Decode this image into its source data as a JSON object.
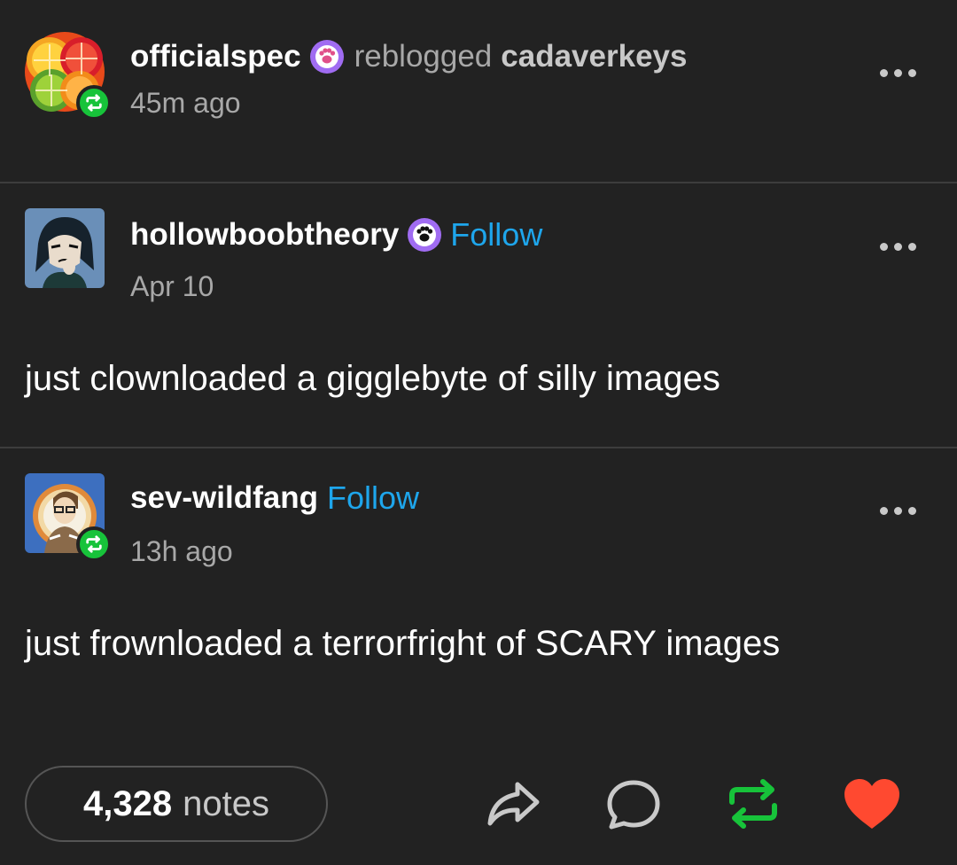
{
  "reblog_header": {
    "username": "officialspec",
    "action_text": "reblogged",
    "original_username": "cadaverkeys",
    "time": "45m ago",
    "avatar_icon": "citrus-slices-avatar",
    "badge_icon": "paw-badge-icon",
    "badge_color": "#a06cf2"
  },
  "posts": [
    {
      "username": "hollowboobtheory",
      "follow_label": "Follow",
      "date": "Apr 10",
      "text": "just clownloaded a gigglebyte of silly images",
      "avatar_icon": "cartoon-character-avatar",
      "badge_icon": "paw-badge-icon"
    },
    {
      "username": "sev-wildfang",
      "follow_label": "Follow",
      "date": "13h ago",
      "text": "just frownloaded a terrorfright of SCARY images",
      "avatar_icon": "cartoon-portrait-avatar"
    }
  ],
  "footer": {
    "notes_count": "4,328",
    "notes_label": "notes",
    "share_icon": "share-arrow-icon",
    "comment_icon": "comment-bubble-icon",
    "reblog_icon": "reblog-icon",
    "like_icon": "heart-icon"
  },
  "colors": {
    "background": "#222222",
    "follow": "#1ea6ec",
    "reblog_green": "#17c33a",
    "heart_red": "#ff4930",
    "muted_text": "#a8a8a8"
  }
}
